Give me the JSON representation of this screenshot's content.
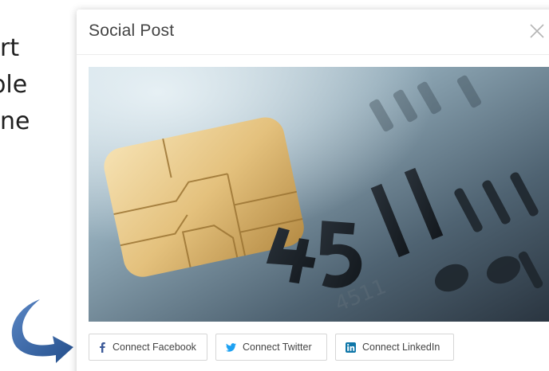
{
  "background": {
    "lines": [
      "rt",
      "able",
      "ne"
    ]
  },
  "modal": {
    "title": "Social Post",
    "close_icon": "close-icon",
    "image_icon": "credit-card-chip-photo"
  },
  "buttons": [
    {
      "label": "Connect Facebook",
      "icon": "facebook-icon",
      "color": "#3b5998"
    },
    {
      "label": "Connect Twitter",
      "icon": "twitter-icon",
      "color": "#1da1f2"
    },
    {
      "label": "Connect LinkedIn",
      "icon": "linkedin-icon",
      "color": "#0e76a8"
    }
  ],
  "colors": {
    "arrow": "#2f5f9e"
  }
}
